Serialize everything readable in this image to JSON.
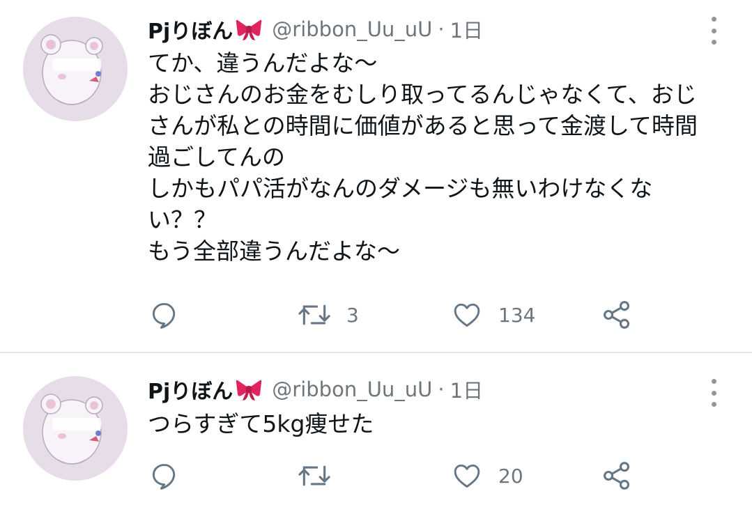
{
  "tweets": [
    {
      "display_name": "Pjりぼん",
      "name_emoji": "ribbon-emoji",
      "handle": "@ribbon_Uu_uU",
      "separator": "·",
      "time": "1日",
      "lines": [
        "てか、違うんだよな〜",
        "おじさんのお金をむしり取ってるんじゃなくて、おじ",
        "さんが私との時間に価値があると思って金渡して時間",
        "過ごしてんの",
        "しかもパパ活がなんのダメージも無いわけなくな",
        "い？？",
        "もう全部違うんだよな〜"
      ],
      "actions": {
        "reply_icon": "reply-icon",
        "retweet_icon": "retweet-icon",
        "retweet_count": "3",
        "like_icon": "heart-icon",
        "like_count": "134",
        "share_icon": "share-icon"
      }
    },
    {
      "display_name": "Pjりぼん",
      "name_emoji": "ribbon-emoji",
      "handle": "@ribbon_Uu_uU",
      "separator": "·",
      "time": "1日",
      "lines": [
        "つらすぎて5kg痩せた"
      ],
      "actions": {
        "reply_icon": "reply-icon",
        "retweet_icon": "retweet-icon",
        "retweet_count": "",
        "like_icon": "heart-icon",
        "like_count": "20",
        "share_icon": "share-icon"
      }
    }
  ],
  "colors": {
    "text": "#0f1419",
    "secondary": "#6e767d",
    "icon": "#657786",
    "avatar_bg": "#e6dde9",
    "ribbon": "#e0245e",
    "divider": "#e3e5e8"
  }
}
